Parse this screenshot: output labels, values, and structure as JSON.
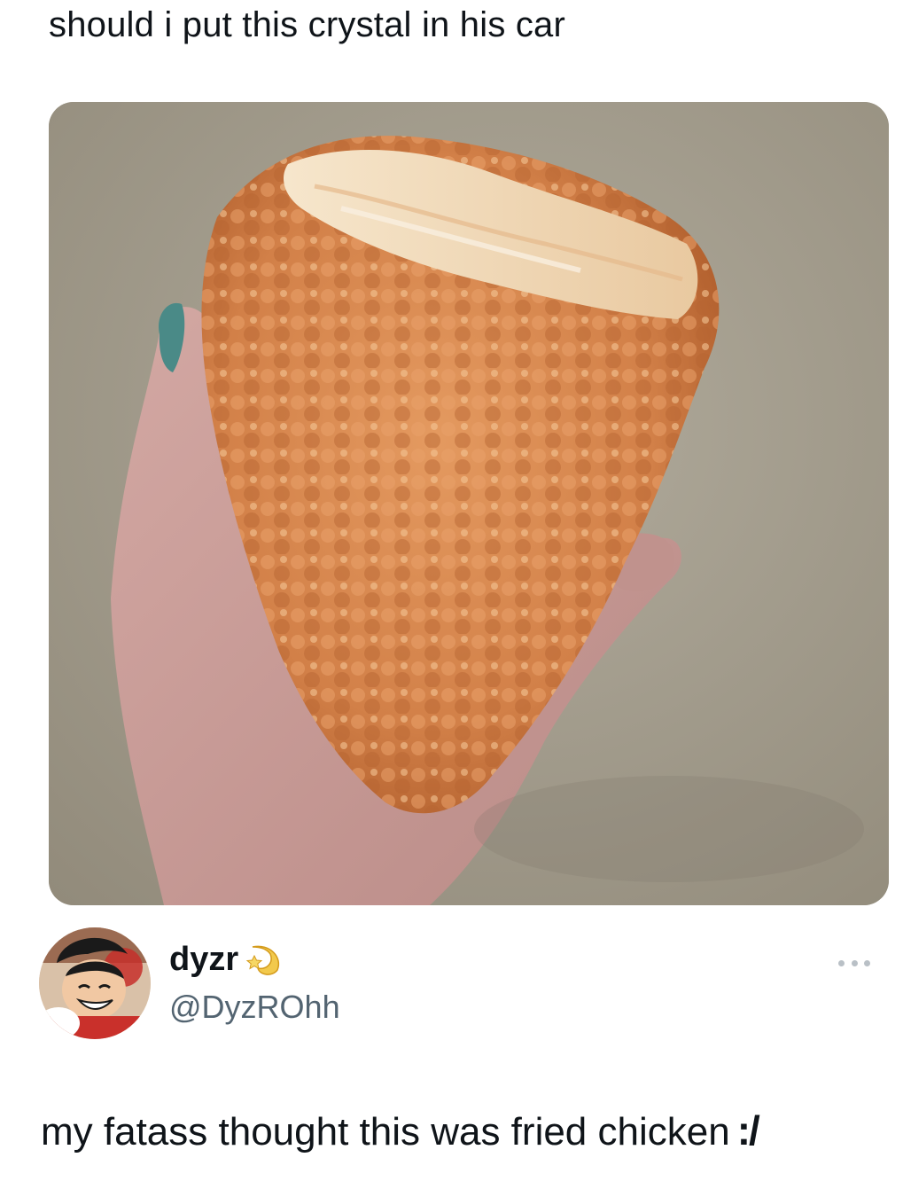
{
  "caption": {
    "text": "should i put this crystal in his car"
  },
  "media": {
    "icon": "crystal-photo",
    "colors": {
      "carpet": "#a9a394",
      "crystal": "#d7884f",
      "crystal_shadow": "#a8582a",
      "crystal_top": "#f1dcbc",
      "skin": "#c69a96",
      "nail": "#4a8a87"
    }
  },
  "author": {
    "display_name": "dyzr",
    "badge_icon": "golden-crescent-star-icon",
    "handle": "@DyzROhh",
    "avatar_icon": "anime-character-avatar",
    "more_icon": "more-horizontal-icon"
  },
  "tweet": {
    "text": "my fatass thought this was fried chicken",
    "emote": ":/"
  }
}
